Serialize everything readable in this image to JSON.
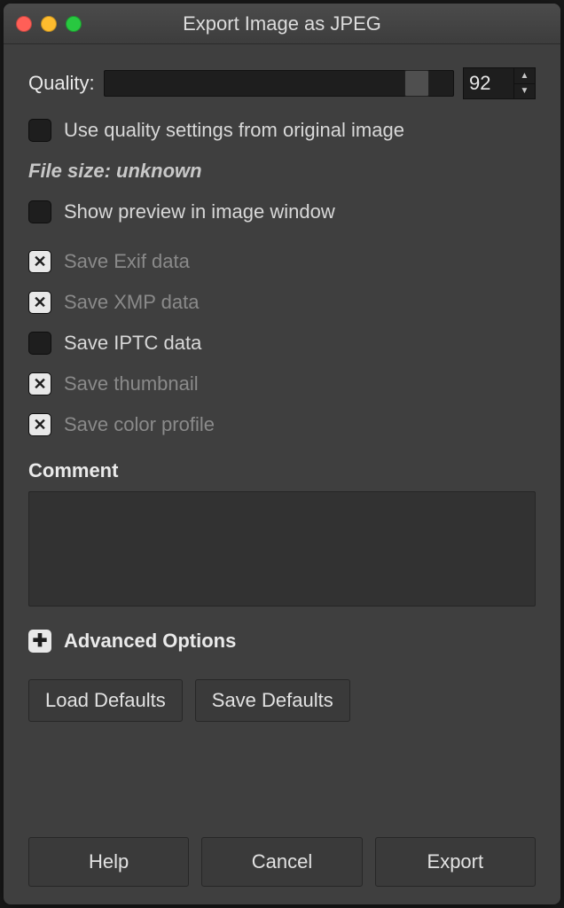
{
  "window": {
    "title": "Export Image as JPEG"
  },
  "quality": {
    "label": "Quality:",
    "value": "92",
    "slider_percent": 92
  },
  "options": {
    "use_original_quality": {
      "label": "Use quality settings from original image",
      "checked": false
    },
    "file_size_text": "File size: unknown",
    "show_preview": {
      "label": "Show preview in image window",
      "checked": false
    },
    "save_exif": {
      "label": "Save Exif data",
      "checked": true,
      "disabled": true
    },
    "save_xmp": {
      "label": "Save XMP data",
      "checked": true,
      "disabled": true
    },
    "save_iptc": {
      "label": "Save IPTC data",
      "checked": false,
      "disabled": false
    },
    "save_thumbnail": {
      "label": "Save thumbnail",
      "checked": true,
      "disabled": true
    },
    "save_color_profile": {
      "label": "Save color profile",
      "checked": true,
      "disabled": true
    }
  },
  "comment": {
    "label": "Comment",
    "value": ""
  },
  "advanced": {
    "label": "Advanced Options"
  },
  "buttons": {
    "load_defaults": "Load Defaults",
    "save_defaults": "Save Defaults",
    "help": "Help",
    "cancel": "Cancel",
    "export": "Export"
  }
}
